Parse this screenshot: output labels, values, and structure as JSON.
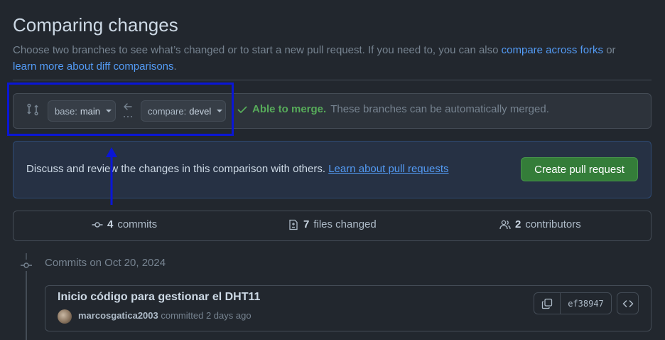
{
  "header": {
    "title": "Comparing changes",
    "subtitle_text": "Choose two branches to see what’s changed or to start a new pull request. If you need to, you can also",
    "compare_forks_link": "compare across forks",
    "or_text": "or",
    "learn_diff_link": "learn more about diff comparisons",
    "period": "."
  },
  "range": {
    "base_label": "base:",
    "base_value": "main",
    "compare_label": "compare:",
    "compare_value": "devel",
    "merge_status": "Able to merge.",
    "merge_description": "These branches can be automatically merged."
  },
  "discuss": {
    "text": "Discuss and review the changes in this comparison with others.",
    "link": "Learn about pull requests",
    "create_button": "Create pull request"
  },
  "summary": {
    "commits_count": "4",
    "commits_label": "commits",
    "files_count": "7",
    "files_label": "files changed",
    "contributors_count": "2",
    "contributors_label": "contributors"
  },
  "commits": {
    "date_heading": "Commits on Oct 20, 2024",
    "items": [
      {
        "title": "Inicio código para gestionar el DHT11",
        "author": "marcosgatica2003",
        "meta": "committed 2 days ago",
        "sha": "ef38947"
      }
    ]
  },
  "colors": {
    "background": "#22272e",
    "link": "#539bf5",
    "success": "#57ab5a",
    "primary_button": "#347d39",
    "annotation": "#0a16d6"
  }
}
